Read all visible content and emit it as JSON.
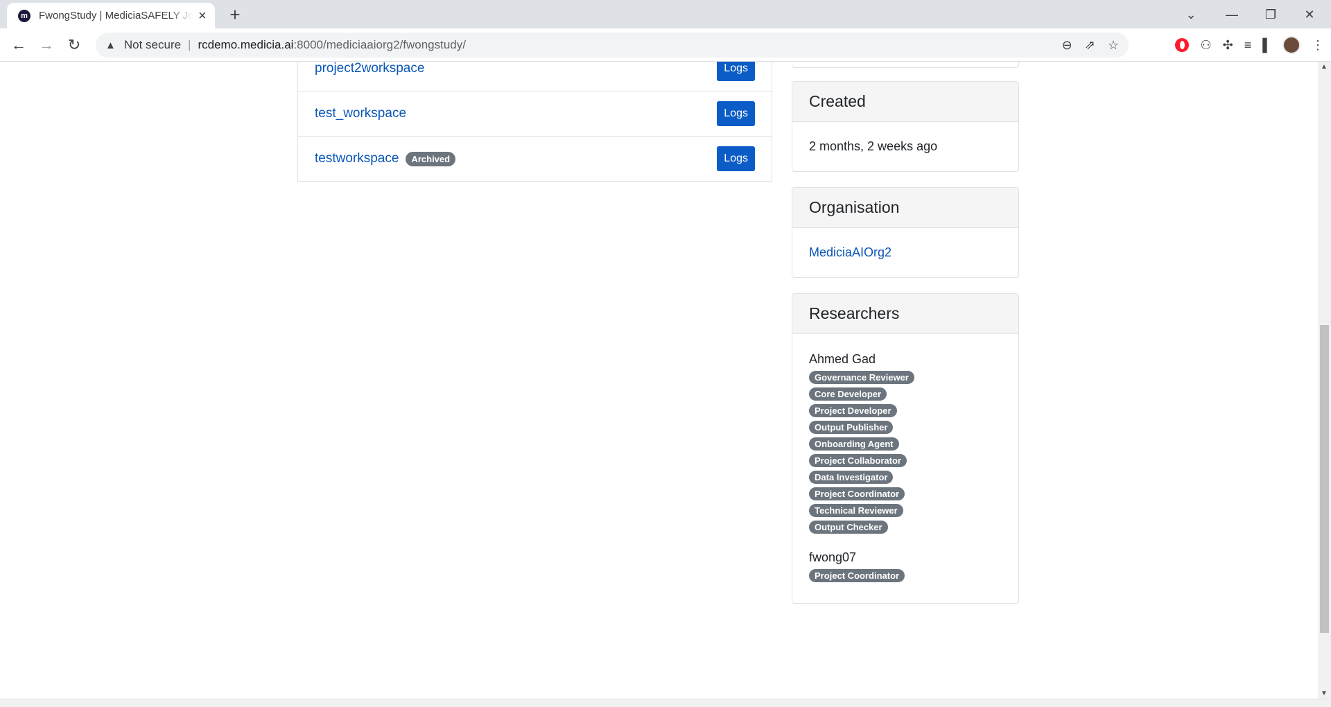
{
  "browser": {
    "tab_title": "FwongStudy | MediciaSAFELY Jobs",
    "favicon_letter": "m",
    "not_secure": "Not secure",
    "url_host": "rcdemo.medicia.ai",
    "url_rest": ":8000/mediciaaiorg2/fwongstudy/"
  },
  "workspaces": [
    {
      "name": "project2workspace",
      "badge": "",
      "action": "Logs"
    },
    {
      "name": "test_workspace",
      "badge": "",
      "action": "Logs"
    },
    {
      "name": "testworkspace",
      "badge": "Archived",
      "action": "Logs"
    }
  ],
  "created": {
    "title": "Created",
    "value": "2 months, 2 weeks ago"
  },
  "organisation": {
    "title": "Organisation",
    "name": "MediciaAIOrg2"
  },
  "researchers": {
    "title": "Researchers",
    "people": [
      {
        "name": "Ahmed Gad",
        "roles": [
          "Governance Reviewer",
          "Core Developer",
          "Project Developer",
          "Output Publisher",
          "Onboarding Agent",
          "Project Collaborator",
          "Data Investigator",
          "Project Coordinator",
          "Technical Reviewer",
          "Output Checker"
        ]
      },
      {
        "name": "fwong07",
        "roles": [
          "Project Coordinator"
        ]
      }
    ]
  }
}
